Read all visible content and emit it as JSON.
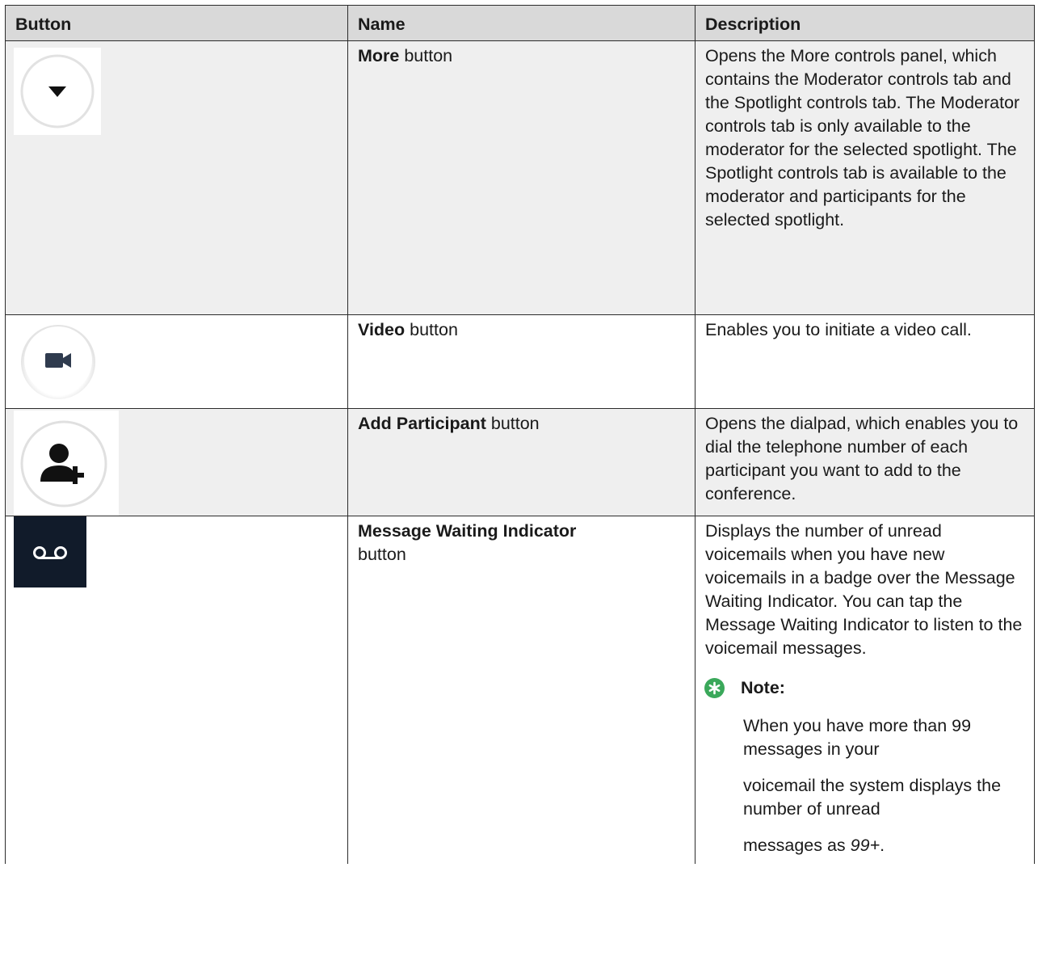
{
  "headers": {
    "button": "Button",
    "name": "Name",
    "description": "Description"
  },
  "rows": [
    {
      "icon": "chevron-down-circle-icon",
      "name_bold": "More",
      "name_rest": " button",
      "description": "Opens the More controls panel, which contains the Moderator controls tab and the Spotlight controls tab. The Moderator controls tab is only available to the moderator for the selected spotlight. The Spotlight controls tab is available to the moderator and participants for the selected spotlight."
    },
    {
      "icon": "video-camera-icon",
      "name_bold": "Video",
      "name_rest": " button",
      "description": "Enables you to initiate a video call."
    },
    {
      "icon": "add-participant-icon",
      "name_bold": "Add Participant",
      "name_rest": " button",
      "description": "Opens the dialpad, which enables you to dial the telephone number of each participant you want to add to the conference."
    },
    {
      "icon": "voicemail-icon",
      "name_bold": "Message Waiting Indicator",
      "name_rest": "button",
      "description": "Displays the number of unread voicemails when you have new voicemails in a badge over the Message Waiting Indicator. You can tap the Message Waiting Indicator to listen to the voicemail messages.",
      "note": {
        "title": "Note:",
        "para1": "When you have more than 99 messages in your",
        "para2": "voicemail the system displays the number of unread",
        "para3_prefix": "messages as ",
        "para3_value": "99+",
        "para3_suffix": "."
      }
    }
  ],
  "colors": {
    "header_bg": "#d9d9d9",
    "row_shade": "#efefef",
    "note_badge": "#3aa85a",
    "voicemail_bg": "#111b2a"
  }
}
